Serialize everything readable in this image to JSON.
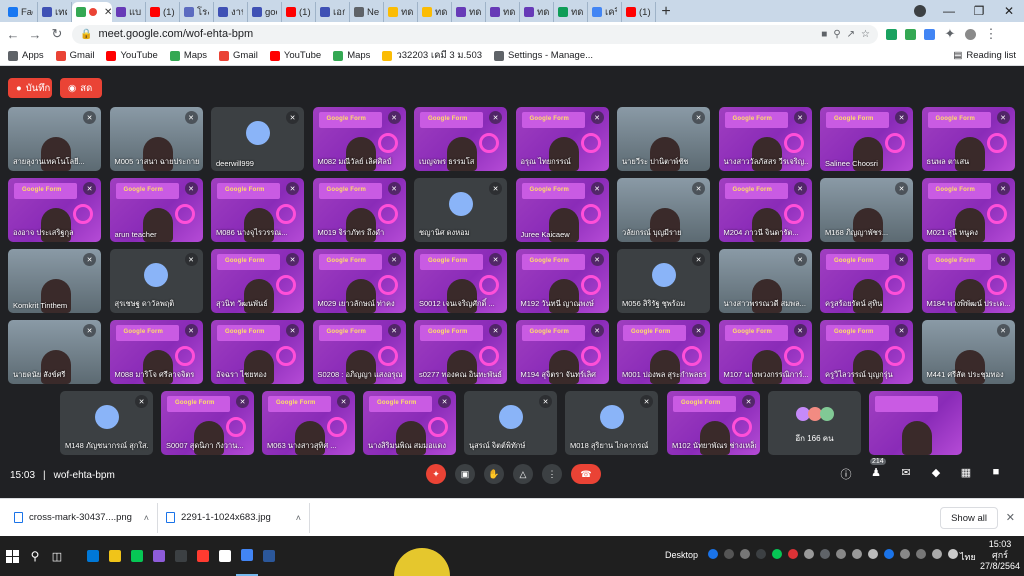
{
  "browser": {
    "tabs": [
      {
        "title": "Faceb",
        "color": "#1877f2",
        "active": false
      },
      {
        "title": "เทคนิ",
        "color": "#3f51b5",
        "active": false
      },
      {
        "title": "",
        "color": "#34a853",
        "active": true
      },
      {
        "title": "แบบท",
        "color": "#673ab7",
        "active": false
      },
      {
        "title": "(1) อ",
        "color": "#ff0000",
        "active": false
      },
      {
        "title": "โรงเรี",
        "color": "#5c6bc0",
        "active": false
      },
      {
        "title": "งานค",
        "color": "#3f51b5",
        "active": false
      },
      {
        "title": "goog",
        "color": "#3f51b5",
        "active": false
      },
      {
        "title": "(1) อ",
        "color": "#ff0000",
        "active": false
      },
      {
        "title": "เอกส",
        "color": "#3f51b5",
        "active": false
      },
      {
        "title": "New",
        "color": "#5f6368",
        "active": false
      },
      {
        "title": "ทดสะ",
        "color": "#fbbc04",
        "active": false
      },
      {
        "title": "ทดสะ",
        "color": "#fbbc04",
        "active": false
      },
      {
        "title": "ทดสะ",
        "color": "#673ab7",
        "active": false
      },
      {
        "title": "ทดสะ",
        "color": "#673ab7",
        "active": false
      },
      {
        "title": "ทดสะ",
        "color": "#673ab7",
        "active": false
      },
      {
        "title": "ทดสะ",
        "color": "#0f9d58",
        "active": false
      },
      {
        "title": "เครื่อ",
        "color": "#4285f4",
        "active": false
      },
      {
        "title": "(1) ส",
        "color": "#ff0000",
        "active": false
      }
    ],
    "url": "meet.google.com/wof-ehta-bpm",
    "bookmarks": [
      {
        "label": "Apps",
        "color": "#5f6368"
      },
      {
        "label": "Gmail",
        "color": "#ea4335"
      },
      {
        "label": "YouTube",
        "color": "#ff0000"
      },
      {
        "label": "Maps",
        "color": "#34a853"
      },
      {
        "label": "Gmail",
        "color": "#ea4335"
      },
      {
        "label": "YouTube",
        "color": "#ff0000"
      },
      {
        "label": "Maps",
        "color": "#34a853"
      },
      {
        "label": "ว32203 เคมี 3 ม.503",
        "color": "#fbbc04"
      },
      {
        "label": "Settings - Manage...",
        "color": "#5f6368"
      }
    ],
    "reading_list": "Reading list"
  },
  "meet": {
    "record_label": "บันทึก",
    "live_label": "สด",
    "tiles": [
      {
        "name": "สายลุงานเทคโนโลยี...",
        "style": "photo"
      },
      {
        "name": "M005 วาสนา ฉายประกาย...",
        "style": "photo"
      },
      {
        "name": "deerwill999",
        "style": "dark"
      },
      {
        "name": "M082 มณีวัลย์ เลิศศิลป์",
        "style": "purple"
      },
      {
        "name": "เบญจพร ธรรมโส",
        "style": "purple"
      },
      {
        "name": "อรุณ ไทยกรรณ์",
        "style": "purple"
      },
      {
        "name": "นายวีระ ปานิตาพ์ชัช",
        "style": "photo"
      },
      {
        "name": "นางสาววัลภัสสร วีรเจริญ...",
        "style": "purple"
      },
      {
        "name": "Salinee Choosri",
        "style": "purple"
      },
      {
        "name": "ธนพล ตาเสน",
        "style": "purple"
      },
      {
        "name": "องอาจ ประเสริฐกุล",
        "style": "purple"
      },
      {
        "name": "arun teacher",
        "style": "purple"
      },
      {
        "name": "M086 นางจุไรวรรณ...",
        "style": "purple"
      },
      {
        "name": "M019 จิราภัทร ถึงดำ",
        "style": "purple"
      },
      {
        "name": "ชญานิศ ดงหอม",
        "style": "dark"
      },
      {
        "name": "Juree Kaicaew",
        "style": "purple"
      },
      {
        "name": "วลัยกรณ์ บุญมีราย",
        "style": "photo"
      },
      {
        "name": "M204 ภาวนี จินดารัต...",
        "style": "purple"
      },
      {
        "name": "M168 ภิญญาพัชร...",
        "style": "photo"
      },
      {
        "name": "M021 สุนี หนูคง",
        "style": "purple"
      },
      {
        "name": "Komkrit Tinthem",
        "style": "photo"
      },
      {
        "name": "สุรเชษฐ ดาวัลพฤติ",
        "style": "dark"
      },
      {
        "name": "สุวนิท วัฒนพันธ์",
        "style": "purple"
      },
      {
        "name": "M029 เยาวลักษณ์ ท่าคง",
        "style": "purple"
      },
      {
        "name": "S0012 เจนเจริญศักดิ์ ...",
        "style": "purple"
      },
      {
        "name": "M192 วันทนี ญาณพงษ์",
        "style": "purple"
      },
      {
        "name": "M056 สิริรัฐ ชุพร้อม",
        "style": "dark"
      },
      {
        "name": "นางสาวพรรณวดี สมพล...",
        "style": "photo"
      },
      {
        "name": "ครูสร้อยรัตน์ สุทิน",
        "style": "purple"
      },
      {
        "name": "M184 พวงพิพัฒน์ ประเด...",
        "style": "purple"
      },
      {
        "name": "นายดนัย สังข์ศรี",
        "style": "photo"
      },
      {
        "name": "M088 มาริโจ ศรีลาจจิตร",
        "style": "purple"
      },
      {
        "name": "อัจฉรา ไชยทอง",
        "style": "purple"
      },
      {
        "name": "S0208 : อภิญญา แสงอรุณ",
        "style": "purple"
      },
      {
        "name": "s0277 ทองคณ อินทะพันธ์",
        "style": "purple"
      },
      {
        "name": "M194 สุจิตรา จันทร์เลิศ",
        "style": "purple"
      },
      {
        "name": "M001 ปองพล สุระกำพลธร",
        "style": "purple"
      },
      {
        "name": "M107 นางพวงกรรณิการ์...",
        "style": "purple"
      },
      {
        "name": "ครูวิไลวรรณ์ บุญกรุ่น",
        "style": "purple"
      },
      {
        "name": "M441 ศรีสัต ประชุมทอง",
        "style": "photo"
      },
      {
        "name": "M148 ภัญชนากรณ์ สุกใส...",
        "style": "dark"
      },
      {
        "name": "S0007 สุดนิภา กังวาน...",
        "style": "purple"
      },
      {
        "name": "M063 นางสาวสุทิศ ...",
        "style": "purple"
      },
      {
        "name": "นางสิริมนพิณ สมมอแดง",
        "style": "purple"
      },
      {
        "name": "นุสรณ์ จิตต์พิทักษ์",
        "style": "dark"
      },
      {
        "name": "M018 สุริยาน ไกคากรณ์",
        "style": "dark"
      },
      {
        "name": "M102 นัทยาพัณร ช่างเหล็ก",
        "style": "purple"
      }
    ],
    "banner_text": "Google Form",
    "more_label": "อีก 166 คน",
    "time": "15:03",
    "meeting_code": "wof-ehta-bpm",
    "people_count": "214"
  },
  "downloads": {
    "items": [
      {
        "name": "cross-mark-30437....png"
      },
      {
        "name": "2291-1-1024x683.jpg"
      }
    ],
    "show_all": "Show all"
  },
  "taskbar": {
    "desktop_label": "Desktop",
    "language": "ไทย",
    "clock_time": "15:03",
    "clock_day": "ศุกร์",
    "clock_date": "27/8/2564",
    "colors": [
      "#0078d7",
      "#f0c419",
      "#06c755",
      "#8e5cd9",
      "#3c4043",
      "#ff3b30",
      "#ffffff",
      "#4285f4",
      "#2b579a"
    ]
  }
}
